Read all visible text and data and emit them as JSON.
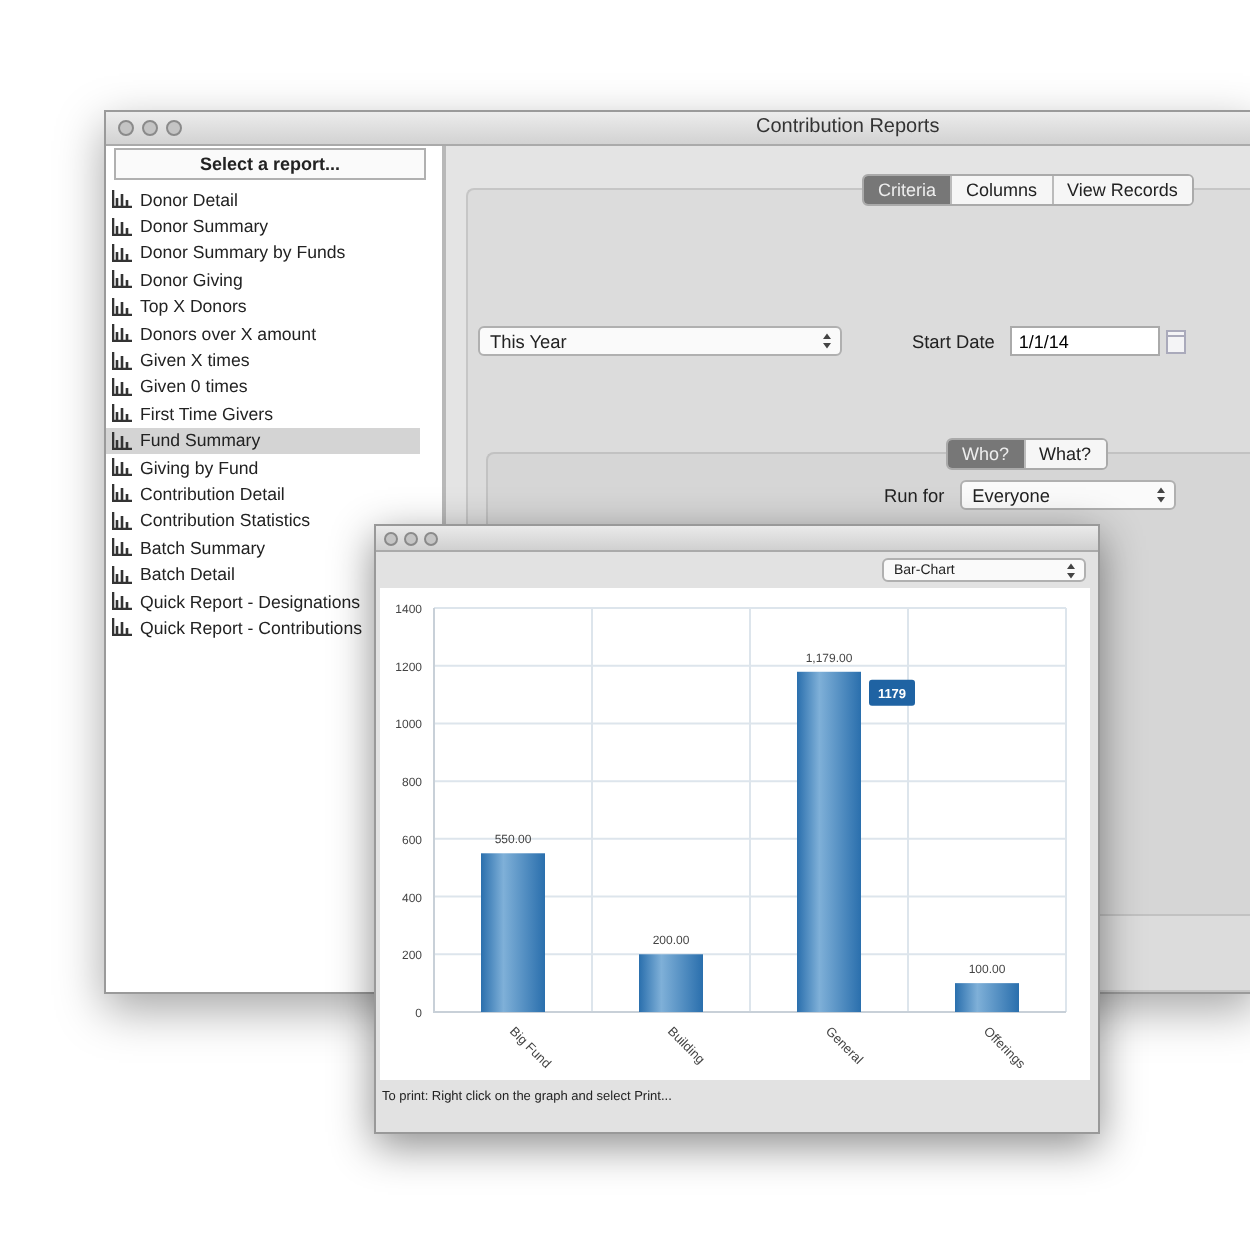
{
  "main_window": {
    "title": "Contribution Reports",
    "report_picker": {
      "label": "Select a report..."
    },
    "reports": [
      {
        "label": "Donor Detail",
        "selected": false
      },
      {
        "label": "Donor Summary",
        "selected": false
      },
      {
        "label": "Donor Summary by Funds",
        "selected": false
      },
      {
        "label": "Donor Giving",
        "selected": false
      },
      {
        "label": "Top X Donors",
        "selected": false
      },
      {
        "label": "Donors over X amount",
        "selected": false
      },
      {
        "label": "Given X times",
        "selected": false
      },
      {
        "label": "Given 0 times",
        "selected": false
      },
      {
        "label": "First Time Givers",
        "selected": false
      },
      {
        "label": "Fund Summary",
        "selected": true
      },
      {
        "label": "Giving by Fund",
        "selected": false
      },
      {
        "label": "Contribution Detail",
        "selected": false
      },
      {
        "label": "Contribution Statistics",
        "selected": false
      },
      {
        "label": "Batch Summary",
        "selected": false
      },
      {
        "label": "Batch Detail",
        "selected": false
      },
      {
        "label": "Quick Report - Designations",
        "selected": false
      },
      {
        "label": "Quick Report - Contributions",
        "selected": false
      }
    ],
    "tabs": [
      {
        "label": "Criteria",
        "selected": true
      },
      {
        "label": "Columns",
        "selected": false
      },
      {
        "label": "View Records",
        "selected": false
      }
    ],
    "period": {
      "value": "This Year"
    },
    "start_date": {
      "label": "Start Date",
      "value": "1/1/14"
    },
    "sub_tabs": [
      {
        "label": "Who?",
        "selected": true
      },
      {
        "label": "What?",
        "selected": false
      }
    ],
    "run_for": {
      "label": "Run for",
      "value": "Everyone"
    }
  },
  "chart_window": {
    "chart_type": {
      "value": "Bar-Chart"
    },
    "chart_data": {
      "type": "bar",
      "categories": [
        "Big Fund",
        "Building",
        "General",
        "Offerings"
      ],
      "series": [
        {
          "color": "#2a6fad",
          "values": [
            550,
            200,
            1179,
            100
          ]
        }
      ],
      "grid": true,
      "ylim": [
        0,
        1400
      ],
      "yticks": [
        0,
        200,
        400,
        600,
        800,
        1000,
        1200,
        1400
      ],
      "value_labels": [
        "550.00",
        "200.00",
        "1,179.00",
        "100.00"
      ],
      "annotations": [
        "1179"
      ]
    },
    "footnote": "To print:  Right click on the graph and select Print..."
  }
}
